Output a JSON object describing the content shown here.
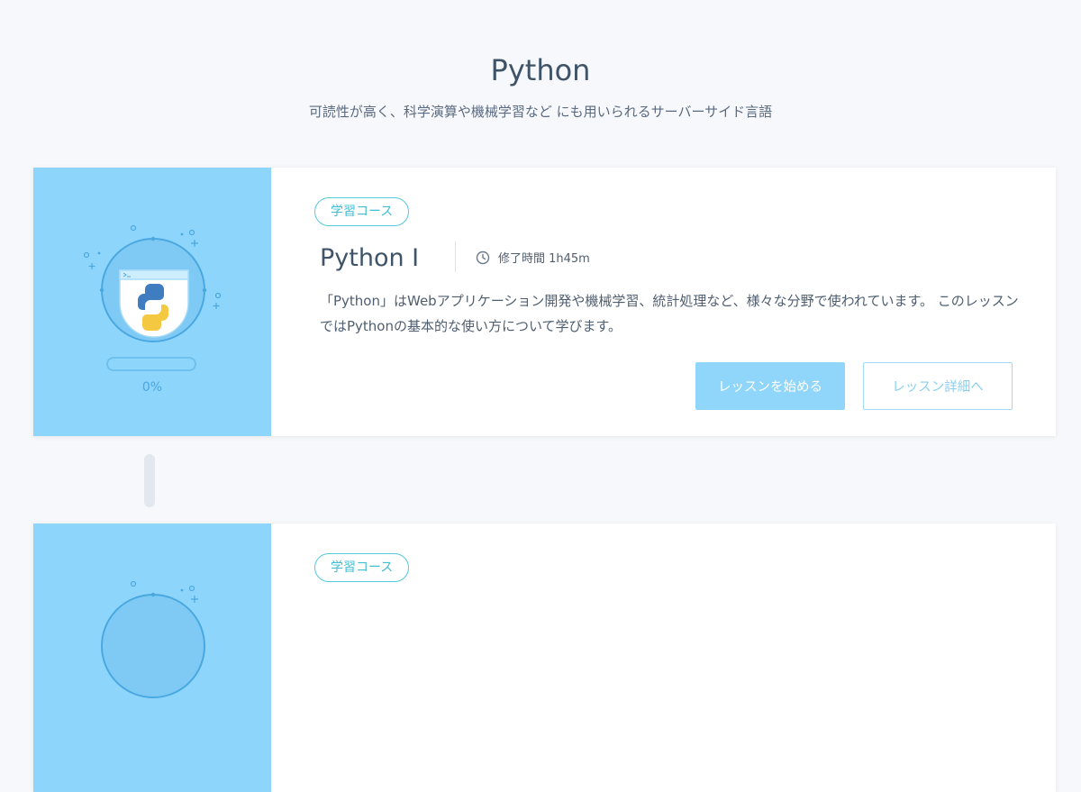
{
  "page": {
    "title": "Python",
    "subtitle": "可読性が高く、科学演算や機械学習など にも用いられるサーバーサイド言語"
  },
  "courses": [
    {
      "badge": "学習コース",
      "title": "Python Ⅰ",
      "duration": "修了時間 1h45m",
      "description": "「Python」はWebアプリケーション開発や機械学習、統計処理など、様々な分野で使われています。 このレッスンではPythonの基本的な使い方について学びます。",
      "progress": 0,
      "progress_label": "0%",
      "start_button": "レッスンを始める",
      "detail_button": "レッスン詳細へ",
      "icon": "python-logo-icon"
    },
    {
      "badge": "学習コース",
      "icon": "python-logo-icon"
    }
  ],
  "colors": {
    "visual_bg": "#8ed5fb",
    "badge_border": "#56c9dc",
    "start_button_bg": "#8fd6fa",
    "detail_button_border": "#9fdbf5",
    "page_bg": "#f7f8fb"
  }
}
